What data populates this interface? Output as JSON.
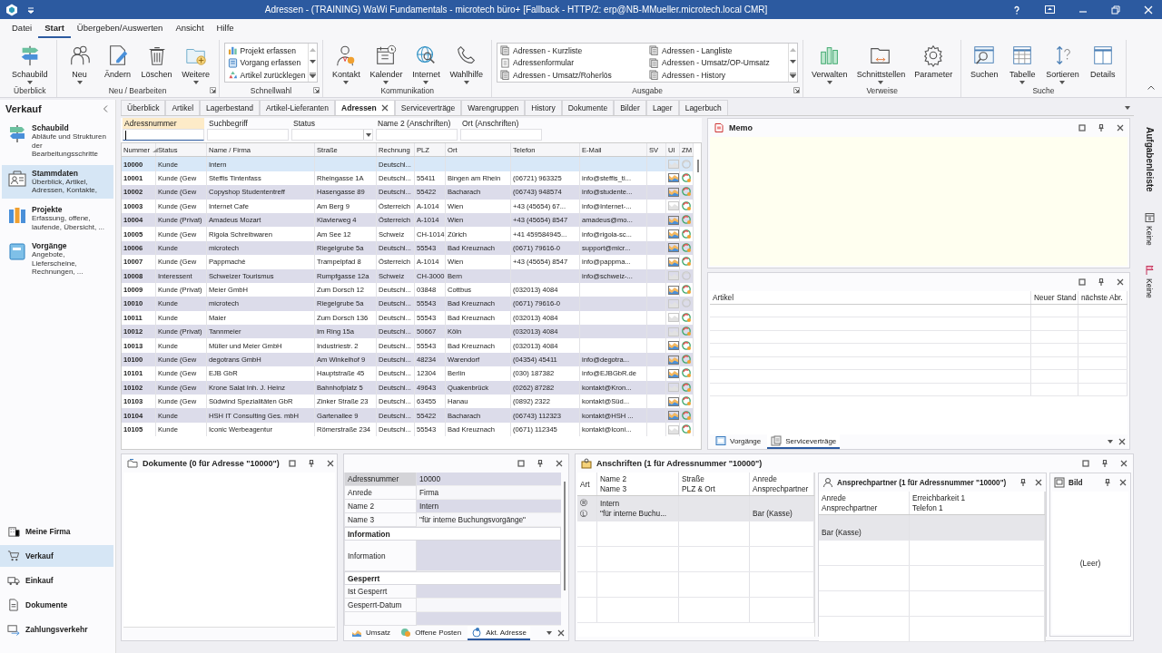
{
  "window": {
    "title": "Adressen - (TRAINING) WaWi Fundamentals - microtech büro+ [Fallback - HTTP/2: erp@NB-MMueller.microtech.local CMR]"
  },
  "menu": [
    {
      "label": "Datei",
      "selected": false
    },
    {
      "label": "Start",
      "selected": true
    },
    {
      "label": "Übergeben/Auswerten",
      "selected": false
    },
    {
      "label": "Ansicht",
      "selected": false
    },
    {
      "label": "Hilfe",
      "selected": false
    }
  ],
  "ribbon": [
    {
      "label": "Überblick",
      "launcher": false,
      "items": [
        {
          "kind": "large",
          "label": "Schaubild",
          "dropdown": true
        }
      ]
    },
    {
      "label": "Neu / Bearbeiten",
      "launcher": true,
      "items": [
        {
          "kind": "large",
          "label": "Neu",
          "dropdown": true
        },
        {
          "kind": "large",
          "label": "Ändern",
          "dropdown": false
        },
        {
          "kind": "large",
          "label": "Löschen",
          "dropdown": false
        },
        {
          "kind": "large",
          "label": "Weitere",
          "dropdown": true
        }
      ]
    },
    {
      "label": "Schnellwahl",
      "launcher": true,
      "items": [
        {
          "kind": "list",
          "entries": [
            "Projekt erfassen",
            "Vorgang erfassen",
            "Artikel zurücklegen"
          ]
        }
      ]
    },
    {
      "label": "Kommunikation",
      "launcher": false,
      "items": [
        {
          "kind": "large",
          "label": "Kontakt",
          "dropdown": true
        },
        {
          "kind": "large",
          "label": "Kalender",
          "dropdown": true
        },
        {
          "kind": "large",
          "label": "Internet",
          "dropdown": true
        },
        {
          "kind": "large",
          "label": "Wahlhilfe",
          "dropdown": true
        }
      ]
    },
    {
      "label": "Ausgabe",
      "launcher": true,
      "items": [
        {
          "kind": "list",
          "entries": [
            "Adressen - Kurzliste",
            "Adressenformular",
            "Adressen - Umsatz/Roherlös",
            "Adressen - Langliste",
            "Adressen - Umsatz/OP-Umsatz",
            "Adressen - History"
          ]
        }
      ]
    },
    {
      "label": "Verweise",
      "launcher": false,
      "items": [
        {
          "kind": "large",
          "label": "Verwalten",
          "dropdown": true
        },
        {
          "kind": "large",
          "label": "Schnittstellen",
          "dropdown": true
        },
        {
          "kind": "large",
          "label": "Parameter",
          "dropdown": false
        }
      ]
    },
    {
      "label": "Suche",
      "launcher": false,
      "items": [
        {
          "kind": "large",
          "label": "Suchen",
          "dropdown": false
        },
        {
          "kind": "large",
          "label": "Tabelle",
          "dropdown": true
        },
        {
          "kind": "large",
          "label": "Sortieren",
          "dropdown": true
        },
        {
          "kind": "large",
          "label": "Details",
          "dropdown": false
        }
      ]
    }
  ],
  "sidebar": {
    "title": "Verkauf",
    "modules": [
      {
        "title": "Schaubild",
        "description": "Abläufe und Strukturen der Bearbeitungsschritte",
        "selected": false
      },
      {
        "title": "Stammdaten",
        "description": "Überblick, Artikel, Adressen, Kontakte,",
        "selected": true
      },
      {
        "title": "Projekte",
        "description": "Erfassung, offene, laufende, Übersicht, ...",
        "selected": false
      },
      {
        "title": "Vorgänge",
        "description": "Angebote, Lieferscheine, Rechnungen, ...",
        "selected": false
      }
    ],
    "nav": [
      {
        "label": "Meine Firma",
        "selected": false
      },
      {
        "label": "Verkauf",
        "selected": true
      },
      {
        "label": "Einkauf",
        "selected": false
      },
      {
        "label": "Dokumente",
        "selected": false
      },
      {
        "label": "Zahlungsverkehr",
        "selected": false
      }
    ]
  },
  "tabs": [
    {
      "label": "Überblick",
      "selected": false
    },
    {
      "label": "Artikel",
      "selected": false
    },
    {
      "label": "Lagerbestand",
      "selected": false
    },
    {
      "label": "Artikel-Lieferanten",
      "selected": false
    },
    {
      "label": "Adressen",
      "selected": true
    },
    {
      "label": "Serviceverträge",
      "selected": false
    },
    {
      "label": "Warengruppen",
      "selected": false
    },
    {
      "label": "History",
      "selected": false
    },
    {
      "label": "Dokumente",
      "selected": false
    },
    {
      "label": "Bilder",
      "selected": false
    },
    {
      "label": "Lager",
      "selected": false
    },
    {
      "label": "Lagerbuch",
      "selected": false
    }
  ],
  "filters": [
    {
      "label": "Adressnummer",
      "kind": "text",
      "focused": true
    },
    {
      "label": "Suchbegriff",
      "kind": "text",
      "focused": false
    },
    {
      "label": "Status",
      "kind": "dropdown",
      "focused": false
    },
    {
      "label": "Name 2 (Anschriften)",
      "kind": "text",
      "focused": false
    },
    {
      "label": "Ort (Anschriften)",
      "kind": "text",
      "focused": false
    }
  ],
  "table": {
    "columns": [
      {
        "label": "Nummer",
        "sorted": true
      },
      {
        "label": "Status",
        "sorted": false
      },
      {
        "label": "Name / Firma",
        "sorted": false
      },
      {
        "label": "Straße",
        "sorted": false
      },
      {
        "label": "Rechnung",
        "sorted": false
      },
      {
        "label": "PLZ",
        "sorted": false
      },
      {
        "label": "Ort",
        "sorted": false
      },
      {
        "label": "Telefon",
        "sorted": false
      },
      {
        "label": "E-Mail",
        "sorted": false
      },
      {
        "label": "SV",
        "sorted": false
      },
      {
        "label": "UI",
        "sorted": false
      },
      {
        "label": "ZM",
        "sorted": false
      }
    ],
    "rows": [
      {
        "number": "10000",
        "status": "Kunde",
        "name": "Intern",
        "invoice": "Deutschl...",
        "ui": false,
        "zm": false,
        "selected": true
      },
      {
        "number": "10001",
        "status": "Kunde (Gew",
        "name": "Steffis Tintenfass",
        "street": "Rheingasse 1A",
        "invoice": "Deutschl...",
        "zip": "55411",
        "city": "Bingen am Rhein",
        "phone": "(06721) 963325",
        "email": "info@steffis_ti...",
        "ui": true,
        "zm": true,
        "selected": false
      },
      {
        "number": "10002",
        "status": "Kunde (Gew",
        "name": "Copyshop Studententreff",
        "street": "Hasengasse 89",
        "invoice": "Deutschl...",
        "zip": "55422",
        "city": "Bacharach",
        "phone": "(06743) 948574",
        "email": "info@studente...",
        "ui": true,
        "zm": true,
        "selected": false
      },
      {
        "number": "10003",
        "status": "Kunde (Gew",
        "name": "Internet Cafe",
        "street": "Am Berg 9",
        "invoice": "Österreich",
        "zip": "A-1014",
        "city": "Wien",
        "phone": "+43 (45654) 67...",
        "email": "info@Internet-...",
        "ui": false,
        "zm": true,
        "selected": false
      },
      {
        "number": "10004",
        "status": "Kunde (Privat)",
        "name": "Amadeus Mozart",
        "street": "Klavierweg 4",
        "invoice": "Österreich",
        "zip": "A-1014",
        "city": "Wien",
        "phone": "+43 (45654) 8547",
        "email": "amadeus@mo...",
        "ui": true,
        "zm": true,
        "selected": false
      },
      {
        "number": "10005",
        "status": "Kunde (Gew",
        "name": "Rigola Schreibwaren",
        "street": "Am See 12",
        "invoice": "Schweiz",
        "zip": "CH-1014",
        "city": "Zürich",
        "phone": "+41 459584945...",
        "email": "info@rigola-sc...",
        "ui": true,
        "zm": true,
        "selected": false
      },
      {
        "number": "10006",
        "status": "Kunde",
        "name": "microtech",
        "street": "Riegelgrube 5a",
        "invoice": "Deutschl...",
        "zip": "55543",
        "city": "Bad Kreuznach",
        "phone": "(0671) 79616-0",
        "email": "support@micr...",
        "ui": true,
        "zm": true,
        "selected": false
      },
      {
        "number": "10007",
        "status": "Kunde (Gew",
        "name": "Pappmachè",
        "street": "Trampelpfad 8",
        "invoice": "Österreich",
        "zip": "A-1014",
        "city": "Wien",
        "phone": "+43 (45654) 8547",
        "email": "info@pappma...",
        "ui": true,
        "zm": true,
        "selected": false
      },
      {
        "number": "10008",
        "status": "Interessent",
        "name": "Schweizer Tourismus",
        "street": "Rumpfgasse 12a",
        "invoice": "Schweiz",
        "zip": "CH-3000",
        "city": "Bern",
        "email": "info@schweiz-...",
        "ui": false,
        "zm": false,
        "selected": false
      },
      {
        "number": "10009",
        "status": "Kunde (Privat)",
        "name": "Meier GmbH",
        "street": "Zum Dorsch 12",
        "invoice": "Deutschl...",
        "zip": "03848",
        "city": "Cottbus",
        "phone": "(032013) 4084",
        "ui": true,
        "zm": true,
        "selected": false
      },
      {
        "number": "10010",
        "status": "Kunde",
        "name": "microtech",
        "street": "Riegelgrube 5a",
        "invoice": "Deutschl...",
        "zip": "55543",
        "city": "Bad Kreuznach",
        "phone": "(0671) 79616-0",
        "ui": false,
        "zm": false,
        "selected": false
      },
      {
        "number": "10011",
        "status": "Kunde",
        "name": "Maier",
        "street": "Zum Dorsch 136",
        "invoice": "Deutschl...",
        "zip": "55543",
        "city": "Bad Kreuznach",
        "phone": "(032013) 4084",
        "ui": false,
        "zm": true,
        "selected": false
      },
      {
        "number": "10012",
        "status": "Kunde (Privat)",
        "name": "Tannmeier",
        "street": "Im Ring 15a",
        "invoice": "Deutschl...",
        "zip": "50667",
        "city": "Köln",
        "phone": "(032013) 4084",
        "ui": false,
        "zm": true,
        "selected": false
      },
      {
        "number": "10013",
        "status": "Kunde",
        "name": "Müller und Meier GmbH",
        "street": "Industriestr. 2",
        "invoice": "Deutschl...",
        "zip": "55543",
        "city": "Bad Kreuznach",
        "phone": "(032013) 4084",
        "ui": true,
        "zm": true,
        "selected": false
      },
      {
        "number": "10100",
        "status": "Kunde (Gew",
        "name": "degotrans GmbH",
        "street": "Am Winkelhof 9",
        "invoice": "Deutschl...",
        "zip": "48234",
        "city": "Warendorf",
        "phone": "(04354) 45411",
        "email": "info@degotra...",
        "ui": true,
        "zm": true,
        "selected": false
      },
      {
        "number": "10101",
        "status": "Kunde (Gew",
        "name": "EJB GbR",
        "street": "Hauptstraße 45",
        "invoice": "Deutschl...",
        "zip": "12304",
        "city": "Berlin",
        "phone": "(030) 187382",
        "email": "info@EJBGbR.de",
        "ui": true,
        "zm": true,
        "selected": false
      },
      {
        "number": "10102",
        "status": "Kunde (Gew",
        "name": "Krone Salat Inh. J. Heinz",
        "street": "Bahnhofplatz 5",
        "invoice": "Deutschl...",
        "zip": "49643",
        "city": "Quakenbrück",
        "phone": "(0262) 87282",
        "email": "kontakt@Kron...",
        "ui": false,
        "zm": true,
        "selected": false
      },
      {
        "number": "10103",
        "status": "Kunde (Gew",
        "name": "Südwind Spezialitäten GbR",
        "street": "Zinker Straße 23",
        "invoice": "Deutschl...",
        "zip": "63455",
        "city": "Hanau",
        "phone": "(0892) 2322",
        "email": "kontakt@Süd...",
        "ui": true,
        "zm": true,
        "selected": false
      },
      {
        "number": "10104",
        "status": "Kunde",
        "name": "HSH IT Consulting Ges. mbH",
        "street": "Gartenallee 9",
        "invoice": "Deutschl...",
        "zip": "55422",
        "city": "Bacharach",
        "phone": "(06743) 112323",
        "email": "kontakt@HSH ...",
        "ui": true,
        "zm": true,
        "selected": false
      },
      {
        "number": "10105",
        "status": "Kunde",
        "name": "Iconic Werbeagentur",
        "street": "Römerstraße 234",
        "invoice": "Deutschl...",
        "zip": "55543",
        "city": "Bad Kreuznach",
        "phone": "(0671) 112345",
        "email": "kontakt@Iconi...",
        "ui": false,
        "zm": true,
        "selected": false
      }
    ]
  },
  "memo": {
    "title": "Memo"
  },
  "service_panel": {
    "columns": [
      "Artikel",
      "Neuer Stand",
      "nächste Abr."
    ],
    "tabs": [
      {
        "label": "Vorgänge",
        "selected": false
      },
      {
        "label": "Serviceverträge",
        "selected": true
      }
    ]
  },
  "documents": {
    "title": "Dokumente (0 für Adresse \"10000\")"
  },
  "details": {
    "rows": [
      {
        "kind": "field",
        "label": "Adressnummer",
        "value": "10000",
        "shaded": true,
        "focused": true
      },
      {
        "kind": "field",
        "label": "Anrede",
        "value": "Firma",
        "shaded": false,
        "focused": false
      },
      {
        "kind": "field",
        "label": "Name 2",
        "value": "Intern",
        "shaded": true,
        "focused": false
      },
      {
        "kind": "field",
        "label": "Name 3",
        "value": "\"für interne Buchungsvorgänge\"",
        "shaded": false,
        "focused": false
      },
      {
        "kind": "section",
        "label": "Information"
      },
      {
        "kind": "tall",
        "label": "Information",
        "shaded": true,
        "focused": false
      },
      {
        "kind": "section",
        "label": "Gesperrt"
      },
      {
        "kind": "field",
        "label": "Ist Gesperrt",
        "shaded": true,
        "focused": false
      },
      {
        "kind": "field",
        "label": "Gesperrt-Datum",
        "shaded": false,
        "focused": false
      },
      {
        "kind": "field",
        "shaded": true,
        "focused": false
      }
    ],
    "tabs": [
      {
        "label": "Umsatz",
        "selected": false
      },
      {
        "label": "Offene Posten",
        "selected": false
      },
      {
        "label": "Akt. Adresse",
        "selected": true
      }
    ]
  },
  "addresses": {
    "title": "Anschriften (1 für Adressnummer \"10000\")",
    "columns": [
      {
        "top": "Art"
      },
      {
        "top": "Name 2",
        "bottom": "Name 3"
      },
      {
        "top": "Straße",
        "bottom": "PLZ & Ort"
      },
      {
        "top": "Anrede",
        "bottom": "Ansprechpartner"
      }
    ],
    "rows": [
      {
        "art": [
          "Ⓡ",
          "Ⓛ"
        ],
        "name2": "Intern",
        "name3": "\"für interne Buchu...",
        "contact": "Bar (Kasse)"
      }
    ]
  },
  "contacts": {
    "title": "Ansprechpartner (1 für Adressnummer \"10000\")",
    "columns": [
      {
        "top": "Anrede",
        "bottom": "Ansprechpartner"
      },
      {
        "top": "Erreichbarkeit 1",
        "bottom": "Telefon 1"
      }
    ],
    "rows": [
      {
        "contact": "Bar (Kasse)"
      }
    ]
  },
  "picture_panel": {
    "title": "Bild",
    "empty_text": "(Leer)"
  },
  "taskbar": {
    "title": "Aufgabenleiste",
    "items": [
      "Keine",
      "Keine"
    ]
  }
}
